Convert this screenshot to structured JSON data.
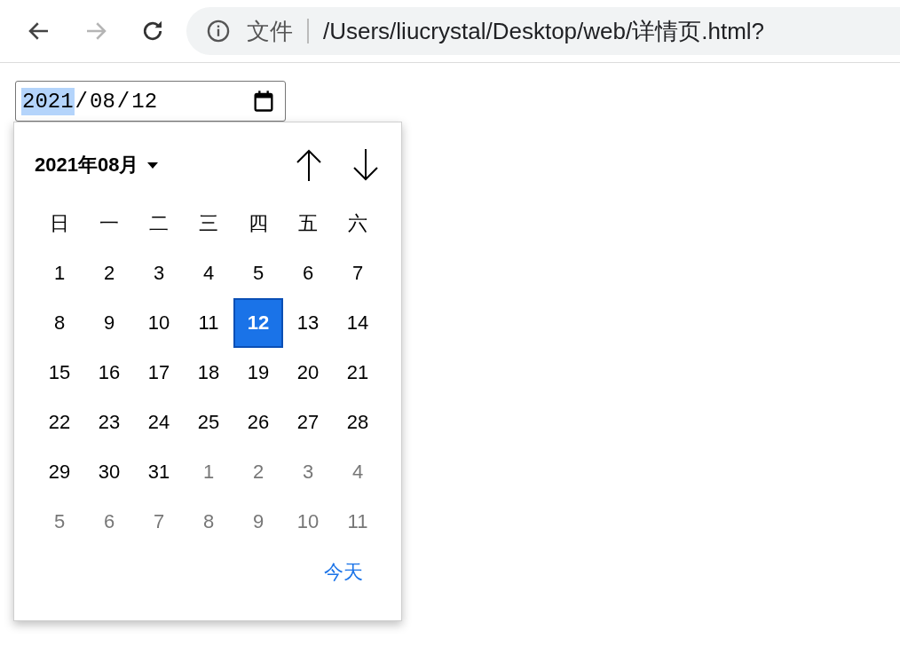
{
  "toolbar": {
    "back": {
      "disabled": false
    },
    "forward": {
      "disabled": true
    },
    "address": {
      "scheme_label": "文件",
      "url": "/Users/liucrystal/Desktop/web/详情页.html?"
    }
  },
  "date_field": {
    "separator": "/",
    "segments": [
      {
        "text": "2021",
        "selected": true
      },
      {
        "text": "08",
        "selected": false
      },
      {
        "text": "12",
        "selected": false
      }
    ]
  },
  "calendar": {
    "month_label": "2021年08月",
    "weekdays": [
      "日",
      "一",
      "二",
      "三",
      "四",
      "五",
      "六"
    ],
    "days": [
      {
        "label": "1",
        "kind": "current",
        "selected": false
      },
      {
        "label": "2",
        "kind": "current",
        "selected": false
      },
      {
        "label": "3",
        "kind": "current",
        "selected": false
      },
      {
        "label": "4",
        "kind": "current",
        "selected": false
      },
      {
        "label": "5",
        "kind": "current",
        "selected": false
      },
      {
        "label": "6",
        "kind": "current",
        "selected": false
      },
      {
        "label": "7",
        "kind": "current",
        "selected": false
      },
      {
        "label": "8",
        "kind": "current",
        "selected": false
      },
      {
        "label": "9",
        "kind": "current",
        "selected": false
      },
      {
        "label": "10",
        "kind": "current",
        "selected": false
      },
      {
        "label": "11",
        "kind": "current",
        "selected": false
      },
      {
        "label": "12",
        "kind": "current",
        "selected": true
      },
      {
        "label": "13",
        "kind": "current",
        "selected": false
      },
      {
        "label": "14",
        "kind": "current",
        "selected": false
      },
      {
        "label": "15",
        "kind": "current",
        "selected": false
      },
      {
        "label": "16",
        "kind": "current",
        "selected": false
      },
      {
        "label": "17",
        "kind": "current",
        "selected": false
      },
      {
        "label": "18",
        "kind": "current",
        "selected": false
      },
      {
        "label": "19",
        "kind": "current",
        "selected": false
      },
      {
        "label": "20",
        "kind": "current",
        "selected": false
      },
      {
        "label": "21",
        "kind": "current",
        "selected": false
      },
      {
        "label": "22",
        "kind": "current",
        "selected": false
      },
      {
        "label": "23",
        "kind": "current",
        "selected": false
      },
      {
        "label": "24",
        "kind": "current",
        "selected": false
      },
      {
        "label": "25",
        "kind": "current",
        "selected": false
      },
      {
        "label": "26",
        "kind": "current",
        "selected": false
      },
      {
        "label": "27",
        "kind": "current",
        "selected": false
      },
      {
        "label": "28",
        "kind": "current",
        "selected": false
      },
      {
        "label": "29",
        "kind": "current",
        "selected": false
      },
      {
        "label": "30",
        "kind": "current",
        "selected": false
      },
      {
        "label": "31",
        "kind": "current",
        "selected": false
      },
      {
        "label": "1",
        "kind": "other",
        "selected": false
      },
      {
        "label": "2",
        "kind": "other",
        "selected": false
      },
      {
        "label": "3",
        "kind": "other",
        "selected": false
      },
      {
        "label": "4",
        "kind": "other",
        "selected": false
      },
      {
        "label": "5",
        "kind": "other",
        "selected": false
      },
      {
        "label": "6",
        "kind": "other",
        "selected": false
      },
      {
        "label": "7",
        "kind": "other",
        "selected": false
      },
      {
        "label": "8",
        "kind": "other",
        "selected": false
      },
      {
        "label": "9",
        "kind": "other",
        "selected": false
      },
      {
        "label": "10",
        "kind": "other",
        "selected": false
      },
      {
        "label": "11",
        "kind": "other",
        "selected": false
      }
    ],
    "today_button": "今天"
  }
}
